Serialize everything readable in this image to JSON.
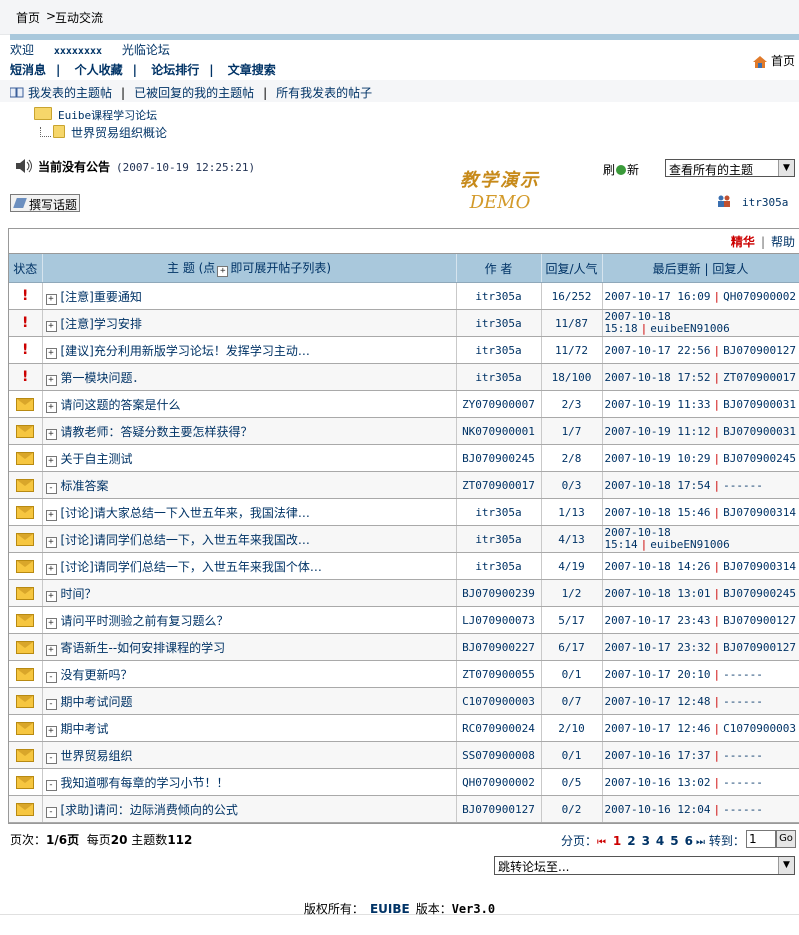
{
  "breadcrumb": {
    "home": "首页",
    "sep": ">",
    "current": "互动交流"
  },
  "welcome": {
    "label": "欢迎",
    "user": "xxxxxxxx",
    "action": "光临论坛"
  },
  "top_links": [
    "短消息",
    "个人收藏",
    "论坛排行",
    "文章搜索"
  ],
  "home_link": "首页",
  "my_links": [
    "我发表的主题帖",
    "已被回复的我的主题帖",
    "所有我发表的帖子"
  ],
  "tree": {
    "forum": "Euibe课程学习论坛",
    "board": "世界贸易组织概论"
  },
  "announcement": {
    "text": "当前没有公告",
    "time": "(2007-10-19 12:25:21)"
  },
  "demo": {
    "cn": "教学演示",
    "en": "DEMO"
  },
  "refresh": {
    "label_a": "刷",
    "label_b": "新"
  },
  "topic_filter": {
    "selected": "查看所有的主题"
  },
  "write_button": "撰写话题",
  "online_user": "itr305a",
  "table_links": {
    "digest": "精华",
    "sep": "|",
    "help": "帮助"
  },
  "columns": {
    "state": "状态",
    "topic": "主 题 (点",
    "topic_hint": "即可展开帖子列表)",
    "author": "作 者",
    "reply": "回复/人气",
    "last": "最后更新 | 回复人"
  },
  "rows": [
    {
      "state": "top",
      "expand": "+",
      "title": "[注意]重要通知",
      "author": "itr305a",
      "reply": "16/252",
      "time": "2007-10-17 16:09",
      "replier": "QH070900002"
    },
    {
      "state": "top",
      "expand": "+",
      "title": "[注意]学习安排",
      "author": "itr305a",
      "reply": "11/87",
      "time": "2007-10-18 15:18",
      "replier": "euibeEN91006",
      "wrap": true
    },
    {
      "state": "top",
      "expand": "+",
      "title": "[建议]充分利用新版学习论坛！发挥学习主动…",
      "author": "itr305a",
      "reply": "11/72",
      "time": "2007-10-17 22:56",
      "replier": "BJ070900127"
    },
    {
      "state": "top",
      "expand": "+",
      "title": "第一模块问题．",
      "author": "itr305a",
      "reply": "18/100",
      "time": "2007-10-18 17:52",
      "replier": "ZT070900017"
    },
    {
      "state": "new",
      "expand": "+",
      "title": "请问这题的答案是什么",
      "author": "ZY070900007",
      "reply": "2/3",
      "time": "2007-10-19 11:33",
      "replier": "BJ070900031"
    },
    {
      "state": "new",
      "expand": "+",
      "title": "请教老师：答疑分数主要怎样获得？",
      "author": "NK070900001",
      "reply": "1/7",
      "time": "2007-10-19 11:12",
      "replier": "BJ070900031"
    },
    {
      "state": "new",
      "expand": "+",
      "title": "关于自主测试",
      "author": "BJ070900245",
      "reply": "2/8",
      "time": "2007-10-19 10:29",
      "replier": "BJ070900245"
    },
    {
      "state": "new",
      "expand": "-",
      "title": "标准答案",
      "author": "ZT070900017",
      "reply": "0/3",
      "time": "2007-10-18 17:54",
      "replier": "------"
    },
    {
      "state": "new",
      "expand": "+",
      "title": "[讨论]请大家总结一下入世五年来，我国法律…",
      "author": "itr305a",
      "reply": "1/13",
      "time": "2007-10-18 15:46",
      "replier": "BJ070900314"
    },
    {
      "state": "new",
      "expand": "+",
      "title": "[讨论]请同学们总结一下，入世五年来我国改…",
      "author": "itr305a",
      "reply": "4/13",
      "time": "2007-10-18 15:14",
      "replier": "euibeEN91006",
      "wrap": true
    },
    {
      "state": "new",
      "expand": "+",
      "title": "[讨论]请同学们总结一下，入世五年来我国个体…",
      "author": "itr305a",
      "reply": "4/19",
      "time": "2007-10-18 14:26",
      "replier": "BJ070900314"
    },
    {
      "state": "new",
      "expand": "+",
      "title": "时间？",
      "author": "BJ070900239",
      "reply": "1/2",
      "time": "2007-10-18 13:01",
      "replier": "BJ070900245"
    },
    {
      "state": "new",
      "expand": "+",
      "title": "请问平时测验之前有复习题么？",
      "author": "LJ070900073",
      "reply": "5/17",
      "time": "2007-10-17 23:43",
      "replier": "BJ070900127"
    },
    {
      "state": "new",
      "expand": "+",
      "title": "寄语新生--如何安排课程的学习",
      "author": "BJ070900227",
      "reply": "6/17",
      "time": "2007-10-17 23:32",
      "replier": "BJ070900127"
    },
    {
      "state": "new",
      "expand": "-",
      "title": "没有更新吗？",
      "author": "ZT070900055",
      "reply": "0/1",
      "time": "2007-10-17 20:10",
      "replier": "------"
    },
    {
      "state": "new",
      "expand": "-",
      "title": "期中考试问题",
      "author": "C1070900003",
      "reply": "0/7",
      "time": "2007-10-17 12:48",
      "replier": "------"
    },
    {
      "state": "new",
      "expand": "+",
      "title": "期中考试",
      "author": "RC070900024",
      "reply": "2/10",
      "time": "2007-10-17 12:46",
      "replier": "C1070900003"
    },
    {
      "state": "new",
      "expand": "-",
      "title": "世界贸易组织",
      "author": "SS070900008",
      "reply": "0/1",
      "time": "2007-10-16 17:37",
      "replier": "------"
    },
    {
      "state": "new",
      "expand": "-",
      "title": "我知道哪有每章的学习小节！！",
      "author": "QH070900002",
      "reply": "0/5",
      "time": "2007-10-16 13:02",
      "replier": "------"
    },
    {
      "state": "new",
      "expand": "-",
      "title": "[求助]请问：边际消费倾向的公式",
      "author": "BJ070900127",
      "reply": "0/2",
      "time": "2007-10-16 12:04",
      "replier": "------"
    }
  ],
  "page_info": {
    "label": "页次：",
    "page": "1/6页",
    "per_label": "每页",
    "per": "20",
    "count_label": "主题数",
    "count": "112"
  },
  "pager": {
    "label": "分页：",
    "pages": [
      "1",
      "2",
      "3",
      "4",
      "5",
      "6"
    ],
    "jump_label": "转到：",
    "jump_value": "1",
    "go": "Go"
  },
  "forum_jump": {
    "selected": "跳转论坛至..."
  },
  "footer": {
    "copyright": "版权所有：",
    "brand": "EUIBE",
    "version_label": "版本：",
    "version": "Ver3.0"
  }
}
